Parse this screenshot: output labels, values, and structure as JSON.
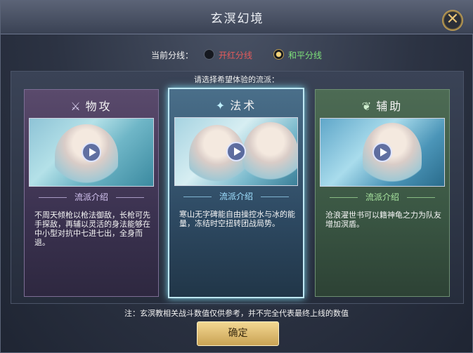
{
  "dialog": {
    "title": "玄溟幻境",
    "close_icon": "close-icon"
  },
  "line_select": {
    "label": "当前分线：",
    "options": [
      {
        "label": "开红分线",
        "selected": false,
        "color": "#e55b5b"
      },
      {
        "label": "和平分线",
        "selected": true,
        "color": "#7ee07a"
      }
    ]
  },
  "prompt": "请选择希望体验的流派：",
  "cards": [
    {
      "title": "物攻",
      "icon": "spear-icon",
      "glyph": "⚔",
      "intro_label": "流派介绍",
      "description": "不周天倾枪以枪法御敌，长枪可先手探敌，再辅以灵活的身法能够在中小型对抗中七进七出，全身而退。",
      "selected": false,
      "accent": "#d6c6f4"
    },
    {
      "title": "法术",
      "icon": "magic-icon",
      "glyph": "✦",
      "intro_label": "流派介绍",
      "description": "寒山无字碑能自由操控水与冰的能量，冻结时空扭转团战局势。",
      "selected": true,
      "accent": "#9fe0ff"
    },
    {
      "title": "辅助",
      "icon": "leaf-icon",
      "glyph": "❦",
      "intro_label": "流派介绍",
      "description": "沧浪濯世书可以籍神龟之力为队友增加溟盾。",
      "selected": false,
      "accent": "#a9e6a0"
    }
  ],
  "note": "注：玄溟教相关战斗数值仅供参考，并不完全代表最终上线的数值",
  "confirm_label": "确定"
}
